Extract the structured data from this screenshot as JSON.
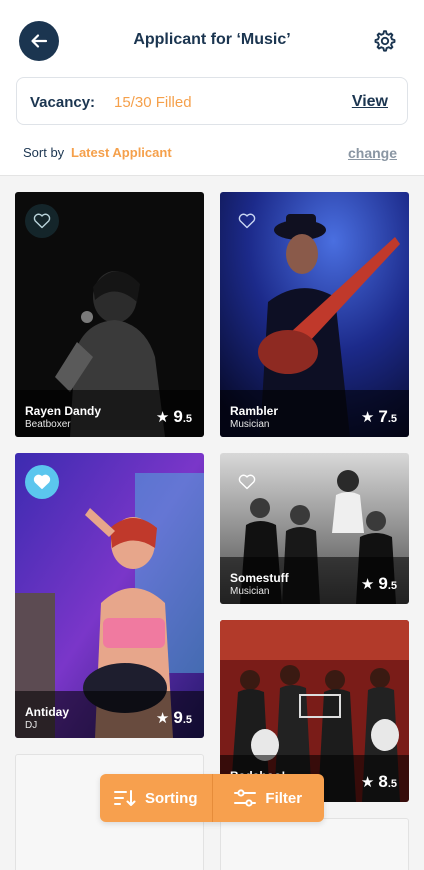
{
  "header": {
    "title": "Applicant for ‘Music’",
    "back_icon": "arrow-left-icon",
    "settings_icon": "gear-icon"
  },
  "vacancy": {
    "label": "Vacancy:",
    "value": "15/30 Filled",
    "view_label": "View"
  },
  "sort": {
    "prefix": "Sort by",
    "value": "Latest Applicant",
    "change_label": "change"
  },
  "applicants": [
    {
      "name": "Rayen Dandy",
      "role": "Beatboxer",
      "rating_int": "9",
      "rating_dec": ".5",
      "favorited": false
    },
    {
      "name": "Rambler",
      "role": "Musician",
      "rating_int": "7",
      "rating_dec": ".5",
      "favorited": false
    },
    {
      "name": "Antiday",
      "role": "DJ",
      "rating_int": "9",
      "rating_dec": ".5",
      "favorited": true
    },
    {
      "name": "Somestuff",
      "role": "Musician",
      "rating_int": "9",
      "rating_dec": ".5",
      "favorited": false
    },
    {
      "name": "Badaboo!",
      "role": "",
      "rating_int": "8",
      "rating_dec": ".5",
      "favorited": false
    }
  ],
  "bottom_bar": {
    "sorting_label": "Sorting",
    "filter_label": "Filter"
  },
  "colors": {
    "navy": "#1b3550",
    "accent": "#f5a04b",
    "favorite": "#5bc6ee"
  }
}
